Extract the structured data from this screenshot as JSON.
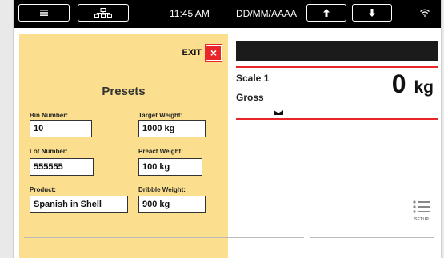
{
  "topbar": {
    "time": "11:45 AM",
    "date_format": "DD/MM/AAAA"
  },
  "presets": {
    "title": "Presets",
    "exit_label": "EXIT",
    "exit_icon": "×",
    "fields": {
      "bin_number": {
        "label": "Bin Number:",
        "value": "10"
      },
      "target_weight": {
        "label": "Target Weight:",
        "value": "1000 kg"
      },
      "lot_number": {
        "label": "Lot Number:",
        "value": "555555"
      },
      "preact_weight": {
        "label": "Preact Weight:",
        "value": "100 kg"
      },
      "product": {
        "label": "Product:",
        "value": "Spanish in Shell"
      },
      "dribble_weight": {
        "label": "Dribble Weight:",
        "value": "900 kg"
      }
    }
  },
  "scale": {
    "name": "Scale 1",
    "mode": "Gross",
    "value": "0",
    "unit": "kg"
  },
  "setup": {
    "label": "SETUP"
  },
  "colors": {
    "accent_red": "#e8262a",
    "panel_yellow": "#fbdf8e",
    "topbar_black": "#000000"
  }
}
